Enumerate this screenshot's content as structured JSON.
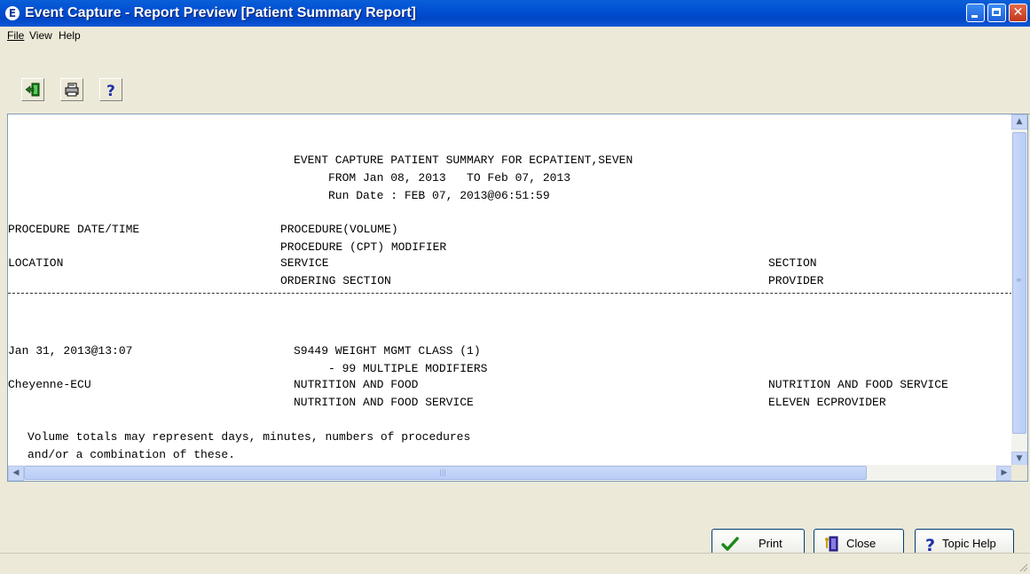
{
  "window": {
    "title": "Event Capture - Report Preview [Patient Summary Report]",
    "app_icon": "E"
  },
  "menu": [
    {
      "label": "File"
    },
    {
      "label": "View"
    },
    {
      "label": "Help"
    }
  ],
  "toolbar": {
    "buttons": [
      {
        "name": "exit-icon",
        "tooltip": ""
      },
      {
        "name": "printer-icon",
        "tooltip": ""
      },
      {
        "name": "help-icon",
        "tooltip": "?"
      }
    ]
  },
  "report": {
    "header_line1": "EVENT CAPTURE PATIENT SUMMARY FOR ECPATIENT,SEVEN",
    "header_line2": "FROM Jan 08, 2013   TO Feb 07, 2013",
    "header_line3": "Run Date : FEB 07, 2013@06:51:59",
    "col_procedure_date": "PROCEDURE DATE/TIME",
    "col_procedure_volume": "PROCEDURE(VOLUME)",
    "col_procedure_cpt": "PROCEDURE (CPT) MODIFIER",
    "col_location": "LOCATION",
    "col_service": "SERVICE",
    "col_section": "SECTION",
    "col_ordering_section": "ORDERING SECTION",
    "col_provider": "PROVIDER",
    "rows": [
      {
        "date": "Jan 31, 2013@13:07",
        "procedure": "S9449 WEIGHT MGMT CLASS (1)",
        "modifier": "- 99 MULTIPLE MODIFIERS",
        "location": "Cheyenne-ECU",
        "service": "NUTRITION AND FOOD",
        "section": "NUTRITION AND FOOD SERVICE",
        "ordering_section": "NUTRITION AND FOOD SERVICE",
        "provider": "ELEVEN ECPROVIDER"
      }
    ],
    "footnote_line1": "Volume totals may represent days, minutes, numbers of procedures",
    "footnote_line2": "and/or a combination of these."
  },
  "buttons": {
    "print": "Print",
    "close": "Close",
    "topic_help": "Topic Help"
  },
  "colors": {
    "titlebar": "#0054e3",
    "window_bg": "#ece9d8",
    "scroll_thumb": "#c1d3fb"
  }
}
